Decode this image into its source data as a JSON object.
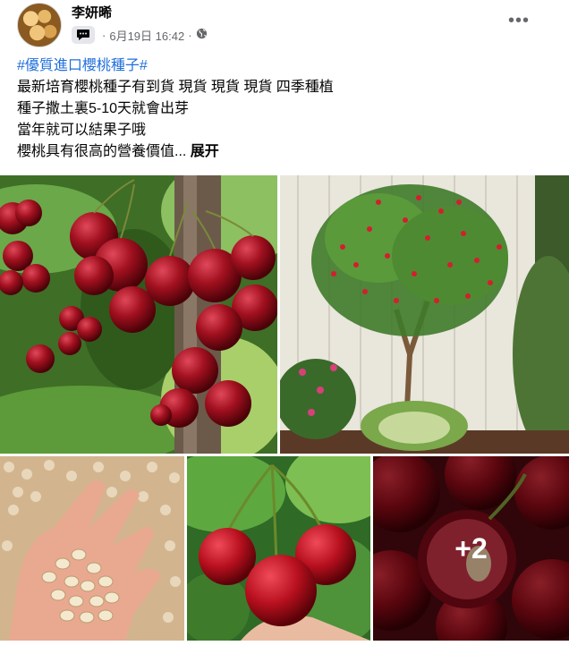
{
  "post": {
    "author": "李妍晞",
    "date": "6月19日 16:42",
    "dot": "·",
    "more_label": "•••",
    "text": {
      "hashtag": "#優質進口櫻桃種子#",
      "line1": "最新培育櫻桃種子有到貨  現貨 現貨 現貨  四季種植",
      "line2": "種子撒土裏5-10天就會出芽",
      "line3": "當年就可以結果子哦",
      "line4": "櫻桃具有很高的營養價值...",
      "expand": "展开"
    },
    "icons": [
      "chat-bubble-icon",
      "globe-icon",
      "more-dots-icon"
    ],
    "photos": {
      "more_count": "+2",
      "items": [
        "cherries-on-branch-photo",
        "cherry-tree-photo",
        "seeds-in-hand-photo",
        "cherry-pair-photo",
        "cut-cherry-photo"
      ]
    }
  }
}
